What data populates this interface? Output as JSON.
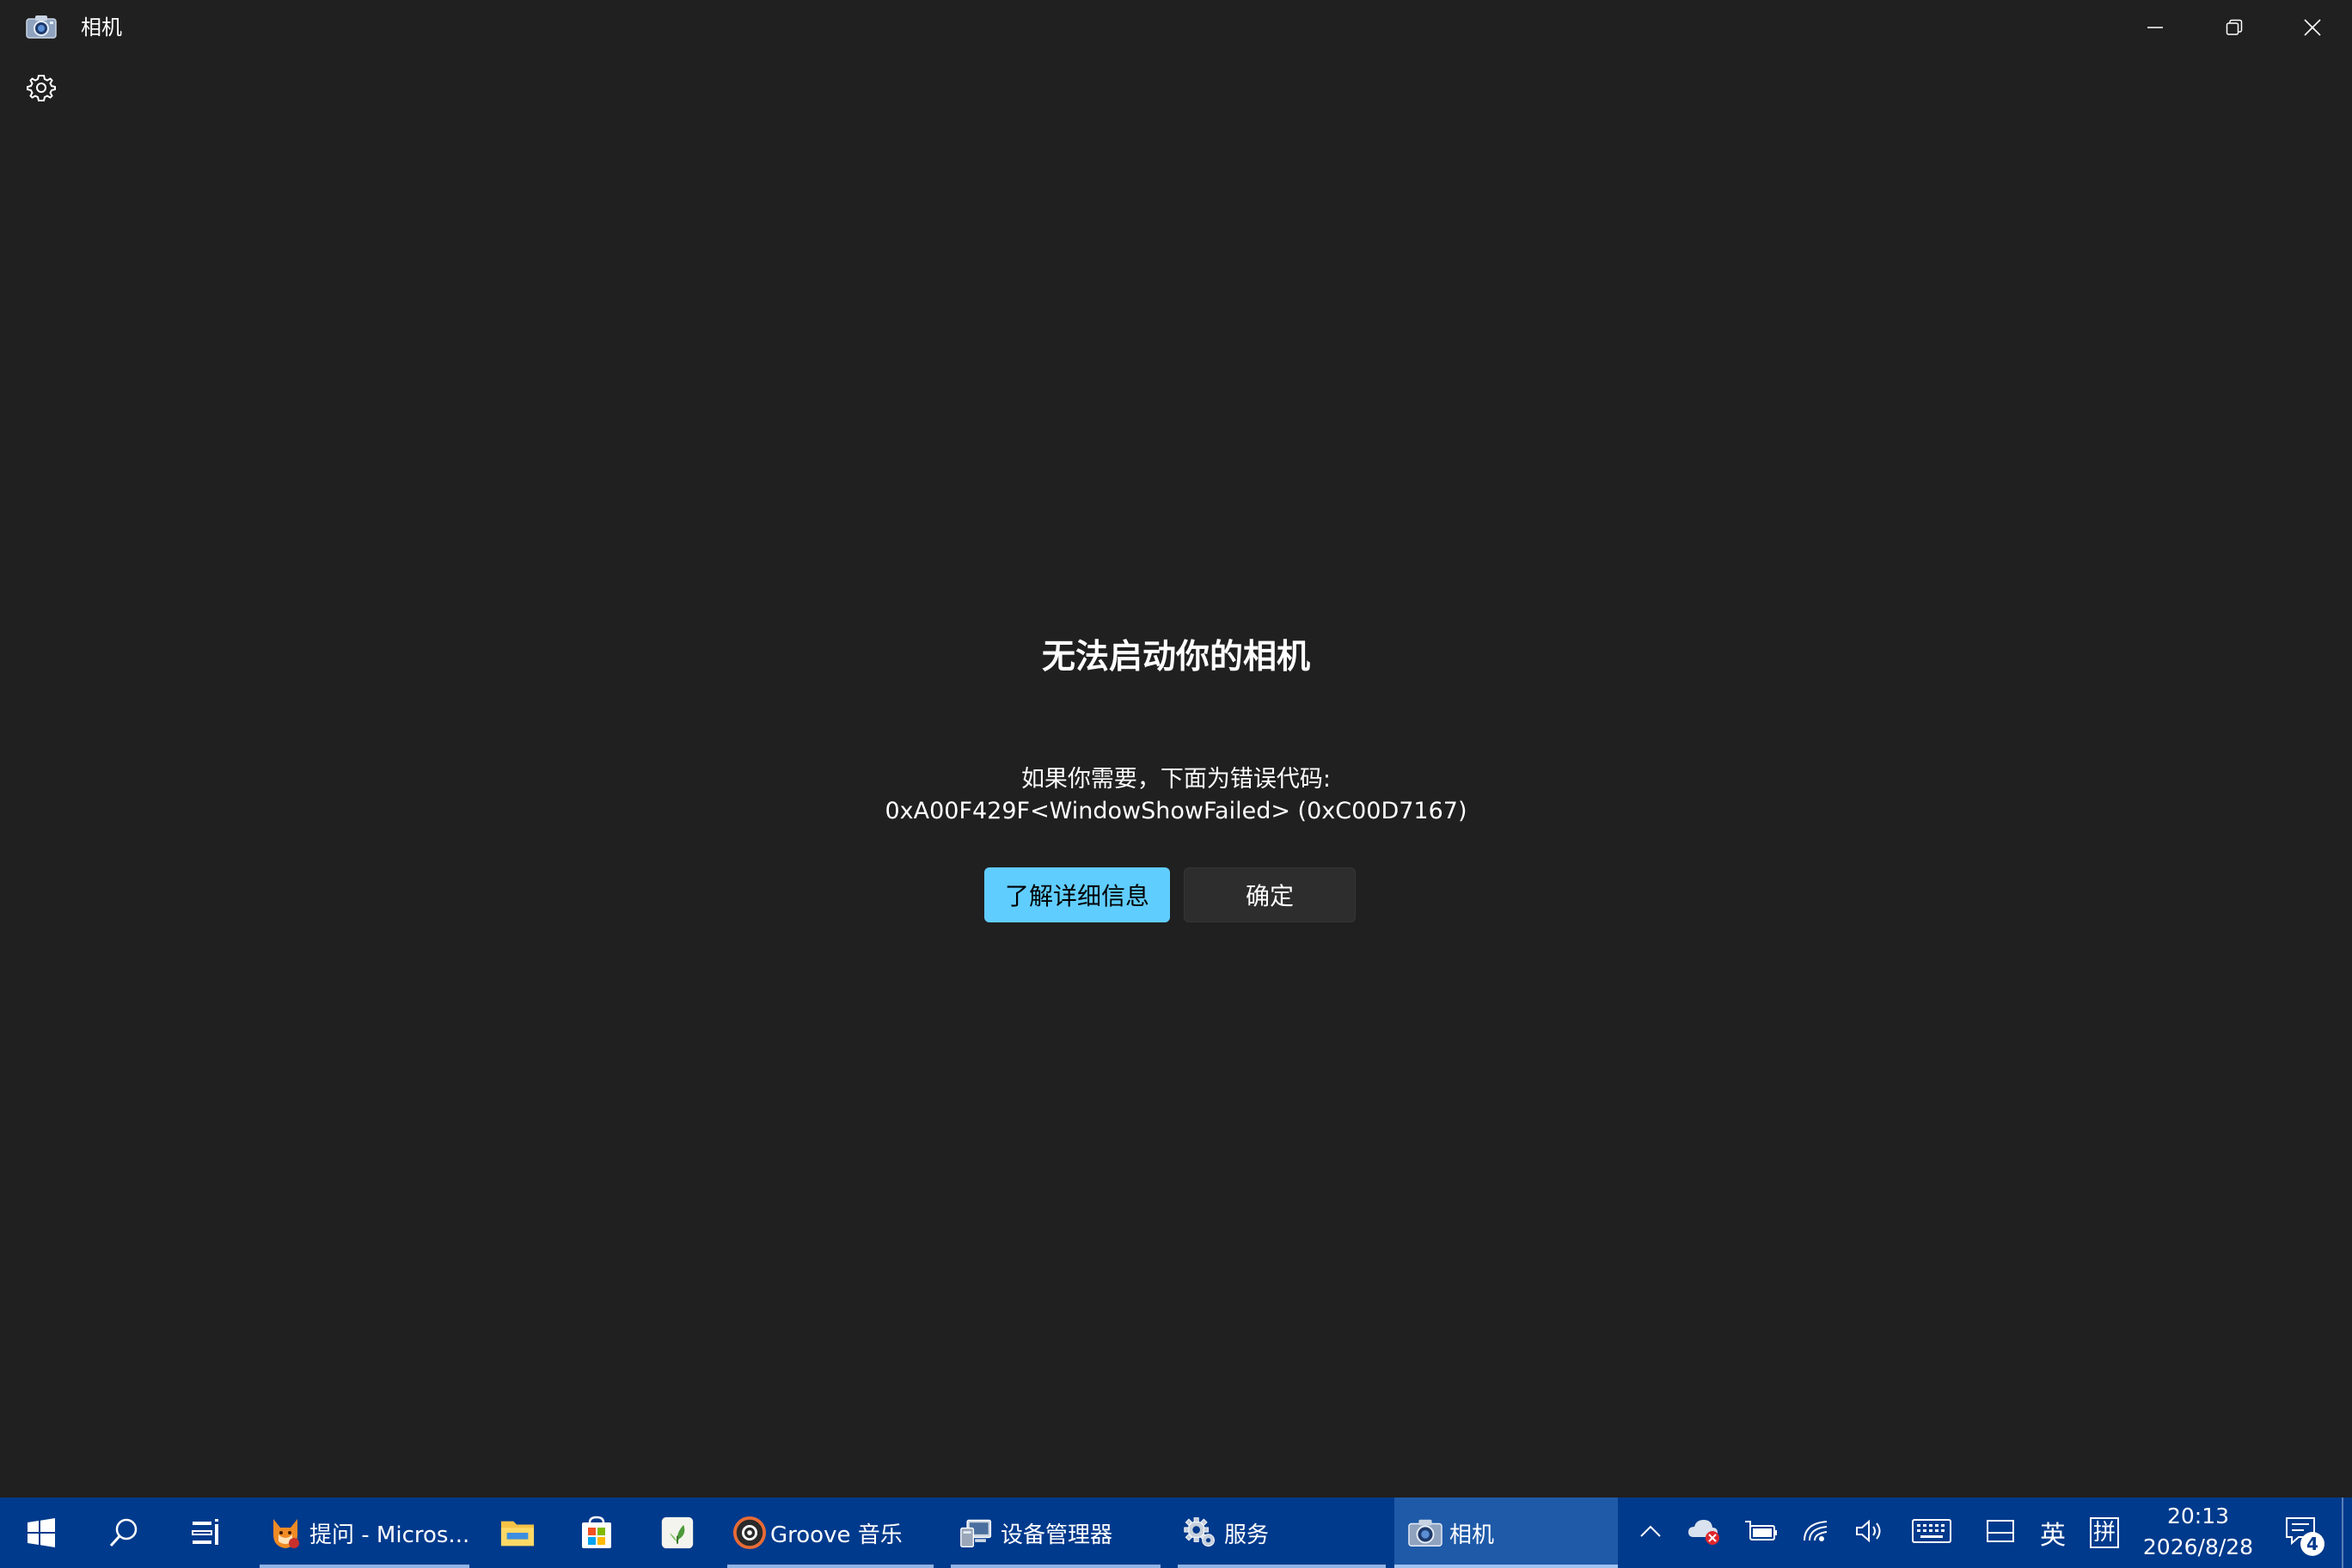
{
  "window": {
    "title": "相机",
    "icons": {
      "app": "camera-icon",
      "settings": "gear-icon",
      "minimize": "minimize-icon",
      "restore": "restore-icon",
      "close": "close-icon"
    }
  },
  "error": {
    "title": "无法启动你的相机",
    "line1": "如果你需要，下面为错误代码:",
    "line2": "0xA00F429F<WindowShowFailed> (0xC00D7167)",
    "primary_button": "了解详细信息",
    "secondary_button": "确定"
  },
  "taskbar": {
    "apps": [
      {
        "name": "start",
        "icon": "windows-logo-icon",
        "label": ""
      },
      {
        "name": "search",
        "icon": "search-icon",
        "label": ""
      },
      {
        "name": "task-view",
        "icon": "task-view-icon",
        "label": ""
      },
      {
        "name": "edge-question",
        "icon": "fox-avatar-icon",
        "label": "提问 - Micros..."
      },
      {
        "name": "file-explorer",
        "icon": "folder-icon",
        "label": ""
      },
      {
        "name": "store",
        "icon": "store-icon",
        "label": ""
      },
      {
        "name": "leaf-app",
        "icon": "leaf-icon",
        "label": ""
      },
      {
        "name": "groove",
        "icon": "groove-music-icon",
        "label": "Groove 音乐"
      },
      {
        "name": "device-manager",
        "icon": "device-manager-icon",
        "label": "设备管理器"
      },
      {
        "name": "services",
        "icon": "gears-icon",
        "label": "服务"
      },
      {
        "name": "camera",
        "icon": "camera-icon",
        "label": "相机"
      }
    ],
    "tray": {
      "ime_lang": "英",
      "ime_mode": "拼",
      "time": "20:13",
      "date": "2026/8/28",
      "notification_count": "4"
    },
    "colors": {
      "background": "#003a8c",
      "active": "#1f5aa8"
    }
  },
  "colors": {
    "accent": "#60cdff",
    "window_bg": "#202020"
  }
}
